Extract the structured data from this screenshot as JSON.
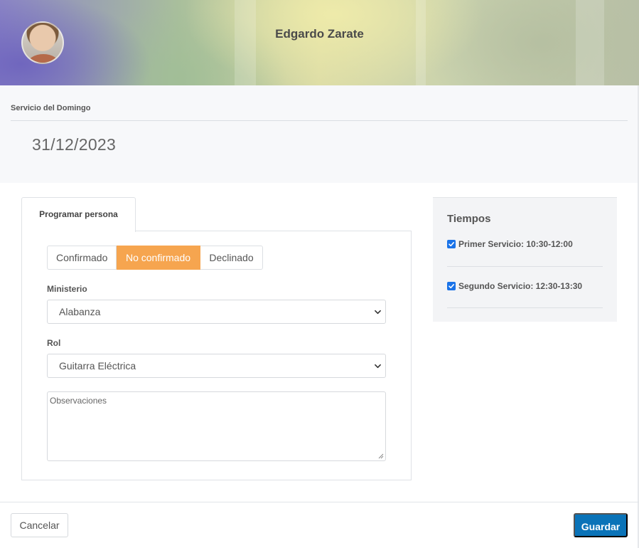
{
  "header": {
    "person_name": "Edgardo Zarate"
  },
  "event": {
    "title": "Servicio del Domingo",
    "date": "31/12/2023"
  },
  "tabs": {
    "active_label": "Programar persona"
  },
  "status": {
    "options": [
      "Confirmado",
      "No confirmado",
      "Declinado"
    ],
    "selected": "No confirmado"
  },
  "form": {
    "ministerio_label": "Ministerio",
    "ministerio_value": "Alabanza",
    "rol_label": "Rol",
    "rol_value": "Guitarra Eléctrica",
    "observaciones_placeholder": "Observaciones"
  },
  "tiempos": {
    "title": "Tiempos",
    "items": [
      {
        "label": "Primer Servicio: 10:30-12:00",
        "checked": true
      },
      {
        "label": "Segundo Servicio: 12:30-13:30",
        "checked": true
      }
    ]
  },
  "footer": {
    "cancel_label": "Cancelar",
    "save_label": "Guardar"
  },
  "colors": {
    "accent_orange": "#f6a54f",
    "primary_blue": "#0a73b8",
    "checkbox_blue": "#1a73e8"
  }
}
